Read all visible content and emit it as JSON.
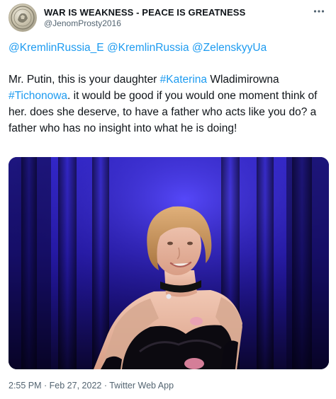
{
  "author": {
    "display_name": "WAR IS WEAKNESS - PEACE IS GREATNESS",
    "handle": "@JenomProsty2016",
    "avatar_icon": "seal-avatar-icon"
  },
  "more_icon": "ellipsis-icon",
  "mentions": [
    "@KremlinRussia_E",
    "@KremlinRussia",
    "@ZelenskyyUa"
  ],
  "body": {
    "part1": "Mr. Putin, this is your daughter ",
    "hashtag1": "#Katerina",
    "part2": " Wladimirowna ",
    "hashtag2": "#Tichonowa",
    "part3": ". it would be good if you would one moment think of her. does she deserve, to have a father who acts like you do? a father who has no insight into what he is doing!"
  },
  "photo": {
    "subject": "photo-of-woman-on-stage"
  },
  "footer": {
    "time": "2:55 PM",
    "sep1": " · ",
    "date": "Feb 27, 2022",
    "sep2": " · ",
    "source": "Twitter Web App"
  },
  "colors": {
    "link": "#1d9bf0",
    "text": "#0f1419",
    "secondary": "#536471",
    "stage_blue": "#3a2fd0"
  }
}
